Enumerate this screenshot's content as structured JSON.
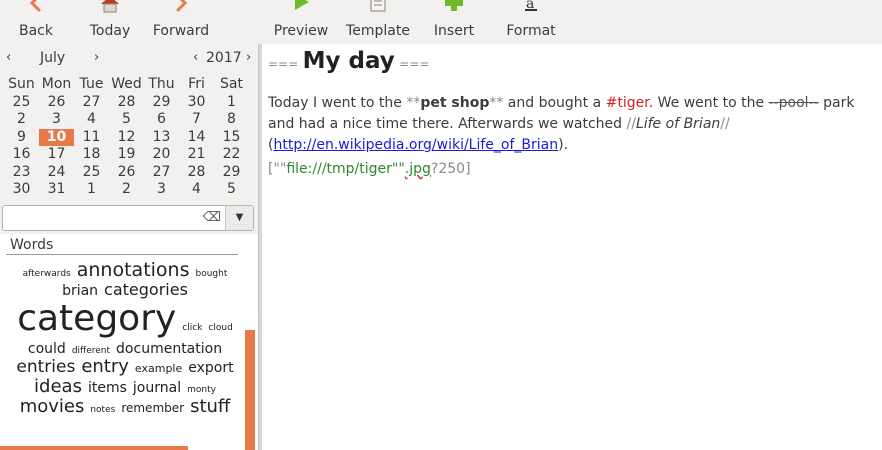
{
  "toolbar": {
    "back": "Back",
    "today": "Today",
    "forward": "Forward",
    "preview": "Preview",
    "template": "Template",
    "insert": "Insert",
    "format": "Format"
  },
  "calendar": {
    "month": "July",
    "year": "2017",
    "prev": "‹",
    "next": "›",
    "weekdays": [
      "Sun",
      "Mon",
      "Tue",
      "Wed",
      "Thu",
      "Fri",
      "Sat"
    ],
    "weeks": [
      [
        "25",
        "26",
        "27",
        "28",
        "29",
        "30",
        "1"
      ],
      [
        "2",
        "3",
        "4",
        "5",
        "6",
        "7",
        "8"
      ],
      [
        "9",
        "10",
        "11",
        "12",
        "13",
        "14",
        "15"
      ],
      [
        "16",
        "17",
        "18",
        "19",
        "20",
        "21",
        "22"
      ],
      [
        "23",
        "24",
        "25",
        "26",
        "27",
        "28",
        "29"
      ],
      [
        "30",
        "31",
        "1",
        "2",
        "3",
        "4",
        "5"
      ]
    ],
    "selected": "10"
  },
  "search": {
    "value": "",
    "clear_icon": "⌫",
    "dropdown_icon": "▼"
  },
  "words": {
    "title": "Words",
    "cloud": [
      {
        "w": "afterwards",
        "s": 9
      },
      {
        "w": "annotations",
        "s": 19
      },
      {
        "w": "bought",
        "s": 9
      },
      {
        "w": "brian",
        "s": 14
      },
      {
        "w": "categories",
        "s": 16
      },
      {
        "w": "category",
        "s": 36
      },
      {
        "w": "click",
        "s": 9
      },
      {
        "w": "cloud",
        "s": 9
      },
      {
        "w": "could",
        "s": 14
      },
      {
        "w": "different",
        "s": 9
      },
      {
        "w": "documentation",
        "s": 14
      },
      {
        "w": "entries",
        "s": 17
      },
      {
        "w": "entry",
        "s": 18
      },
      {
        "w": "example",
        "s": 11
      },
      {
        "w": "export",
        "s": 14
      },
      {
        "w": "ideas",
        "s": 18
      },
      {
        "w": "items",
        "s": 14
      },
      {
        "w": "journal",
        "s": 14
      },
      {
        "w": "monty",
        "s": 9
      },
      {
        "w": "movies",
        "s": 18
      },
      {
        "w": "notes",
        "s": 9
      },
      {
        "w": "remember",
        "s": 12
      },
      {
        "w": "stuff",
        "s": 18
      }
    ]
  },
  "editor": {
    "heading_marker": "===",
    "heading": "My day",
    "p1": "Today I went to the ",
    "bold_marker": "**",
    "bold": "pet shop",
    "p2": " and bought a ",
    "tag": "#tiger",
    "p3": ". We went to the ",
    "strike_marker": "--",
    "strike": "pool",
    "p4": " park and had a nice time there. Afterwards we watched ",
    "italic_marker": "//",
    "italic": "Life of Brian",
    "p5": " (",
    "link": "http://en.wikipedia.org/wiki/Life_of_Brian",
    "p6": ").",
    "img_open": "[\"\"",
    "img_path": "file:///tmp/tiger",
    "img_mid": "\"\"",
    "img_ext": ".jpg",
    "img_close": "?250]"
  },
  "colors": {
    "accent": "#e8794a",
    "tag": "#d71f1f",
    "link": "#1a1adc",
    "image_path": "#2a8a2a"
  }
}
